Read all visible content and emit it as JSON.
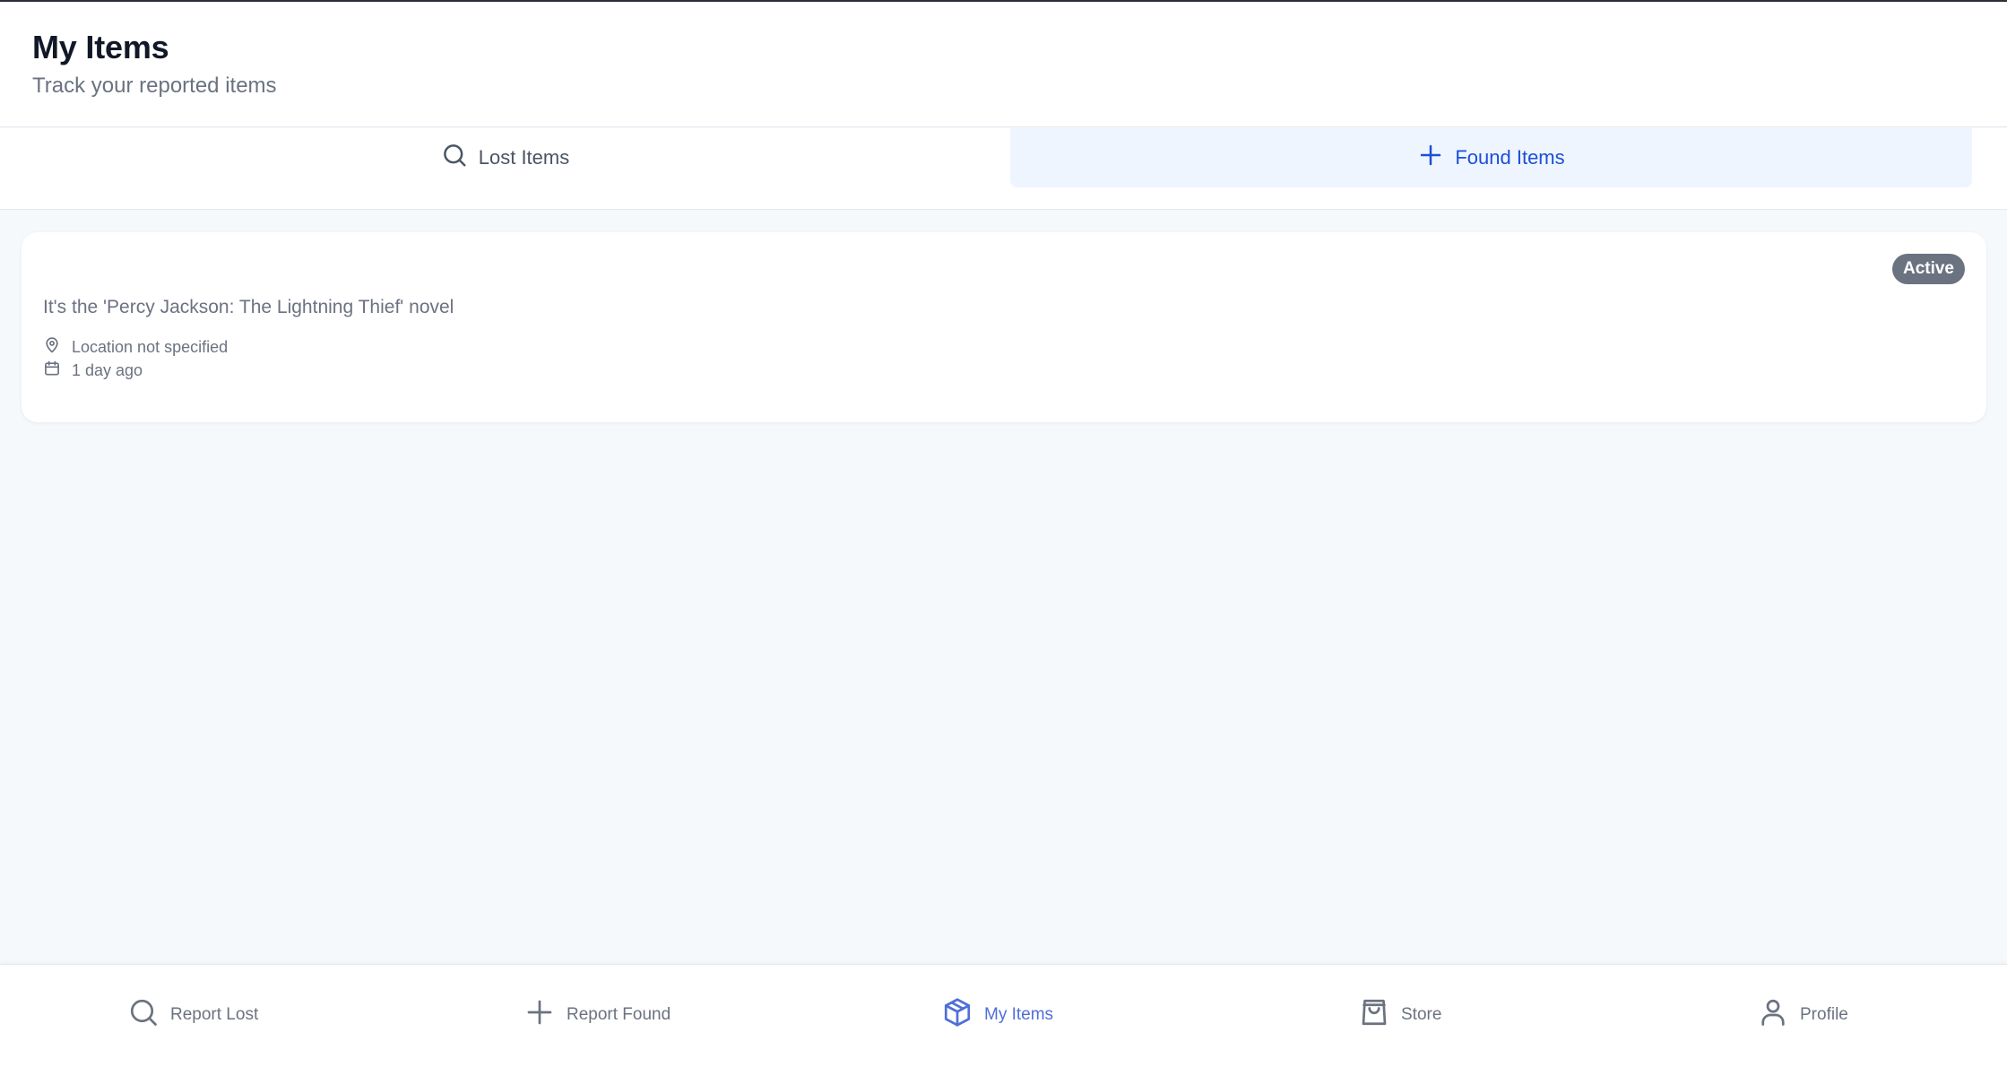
{
  "header": {
    "title": "My Items",
    "subtitle": "Track your reported items"
  },
  "tabs": [
    {
      "label": "Lost Items",
      "icon": "search-icon",
      "active": false
    },
    {
      "label": "Found Items",
      "icon": "plus-icon",
      "active": true
    }
  ],
  "items": [
    {
      "description": "It's the 'Percy Jackson: The Lightning Thief' novel",
      "location": "Location not specified",
      "date": "1 day ago",
      "status": "Active"
    }
  ],
  "bottom_nav": [
    {
      "label": "Report Lost",
      "icon": "search-icon",
      "active": false
    },
    {
      "label": "Report Found",
      "icon": "plus-icon",
      "active": false
    },
    {
      "label": "My Items",
      "icon": "box-icon",
      "active": true
    },
    {
      "label": "Store",
      "icon": "shopping-bag-icon",
      "active": false
    },
    {
      "label": "Profile",
      "icon": "user-icon",
      "active": false
    }
  ],
  "colors": {
    "accent": "#1d4ed8",
    "nav_active": "#4f6fd8",
    "tab_active_bg": "#eef5fe",
    "badge_bg": "#6b7280",
    "page_bg": "#f6f9fc",
    "text_muted": "#6b7280"
  }
}
